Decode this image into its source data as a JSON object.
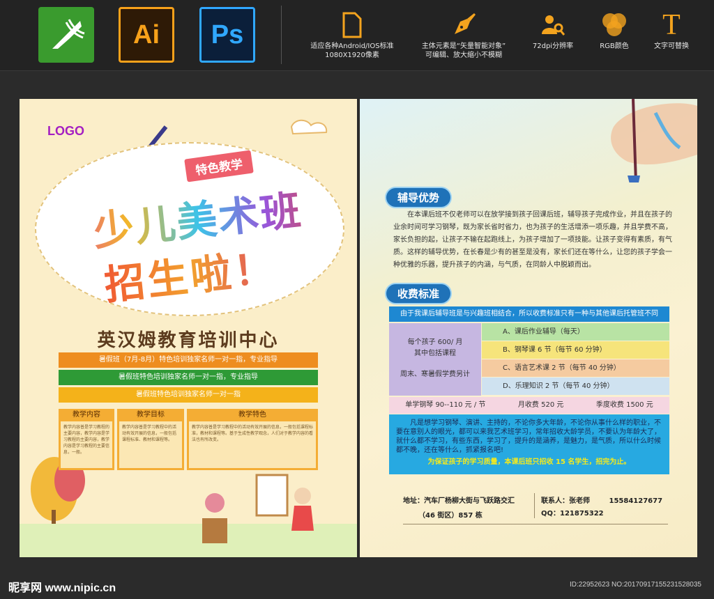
{
  "toolbar": {
    "apps": [
      "Ai",
      "Ps"
    ],
    "features": [
      {
        "icon": "file-icon",
        "lines": [
          "适应各种Android/IOS标准",
          "1080X1920像素"
        ]
      },
      {
        "icon": "pen-nib-icon",
        "lines": [
          "主体元素是“矢量智能对象”",
          "可编辑、放大缩小不模糊"
        ]
      },
      {
        "icon": "user-zoom-icon",
        "lines": [
          "72dpi分辨率",
          ""
        ]
      },
      {
        "icon": "rgb-circles-icon",
        "lines": [
          "RGB颜色",
          ""
        ]
      },
      {
        "icon": "text-T-icon",
        "lines": [
          "文字可替换",
          ""
        ]
      }
    ]
  },
  "left_poster": {
    "logo": "LOGO",
    "ribbon": "特色教学",
    "title_line1": "少儿美术班",
    "title_line2": "招生啦！",
    "center_name": "英汉姆教育培训中心",
    "bars": [
      "暑假班（7月-8月）特色培训独家名师一对一指，专业指导",
      "暑假班特色培训独家名师一对一指，专业指导",
      "暑假班特色培训独家名师一对一指"
    ],
    "columns": [
      {
        "header": "教学内容",
        "body": "教学内容普是学习教程的主要内容，教学内容是学习教程的主要内容，教学内容是学习教程的主要信息，一般。"
      },
      {
        "header": "教学目标",
        "body": "教学内容普是学习教程中的活动有效开展的信息，一般包括课程标准、教材和课程等。"
      },
      {
        "header": "教学特色",
        "body": "教学内容普是学习教程中的活动有效开展的信息，一般包括课程标准，教材和课程等。基于生成性教学观念，人们对于教学内容的看法也有所改变。"
      }
    ]
  },
  "right_poster": {
    "section1_title": "辅导优势",
    "section1_text": "在本课后班不仅老师可以在放学接到孩子回课后班，辅导孩子完成作业，并且在孩子的业余时间可学习钢琴，既为家长省时省力，也为孩子的生活增添一项乐趣，并且学费不高，家长负担的起，让孩子不输在起跑线上，为孩子增加了一项技能。让孩子变得有素质，有气质。这样的辅导优势，在长春是少有的甚至是没有，家长们还在等什么，让您的孩子学会一种优雅的乐器，提升孩子的内涵，与气质，在同龄人中脱颖而出。",
    "section2_title": "收费标准",
    "fee_header": "由于我课后辅导班是与兴趣班相结合，所以收费标准只有一种与其他课后托管班不同",
    "fee_left_line1": "每个孩子 600/ 月",
    "fee_left_line2": "其中包括课程",
    "fee_left_line3": "周末、寒暑假学费另计",
    "fee_items": [
      "A、课后作业辅导（每天）",
      "B、钢琴课 6 节（每节 60 分钟）",
      "C、语言艺术课 2 节（每节 40 分钟）",
      "D、乐理知识 2 节（每节 40 分钟）"
    ],
    "price_single": "单学钢琴 90--110 元 / 节",
    "price_month": "月收费 520 元",
    "price_season": "季度收费 1500 元",
    "notice": "凡是想学习钢琴、演讲、主持的，不论你多大年龄，不论你从事什么样的职业，不要在意别人的眼光，都可以来我艺术班学习，常年招收大龄学员，不要认为年龄大了，就什么都不学习，有些东西，学习了，提升的是涵养，是魅力，是气质，所以什么时候都不晚，还在等什么，抓紧报名吧!",
    "highlight": "为保证孩子的学习质量，本课后班只招收 15 名学生，招完为止。",
    "address_label": "地址：",
    "address_line1": "汽车厂杨柳大街与飞跃路交汇",
    "address_line2": "（46 街区）857 栋",
    "contact_label": "联系人：",
    "contact_name": "张老师",
    "phone": "15584127677",
    "qq_label": "QQ：",
    "qq": "121875322"
  },
  "footer": {
    "site": "昵享网 www.nipic.cn",
    "id_text": "ID:22952623 NO:20170917155231528035"
  }
}
